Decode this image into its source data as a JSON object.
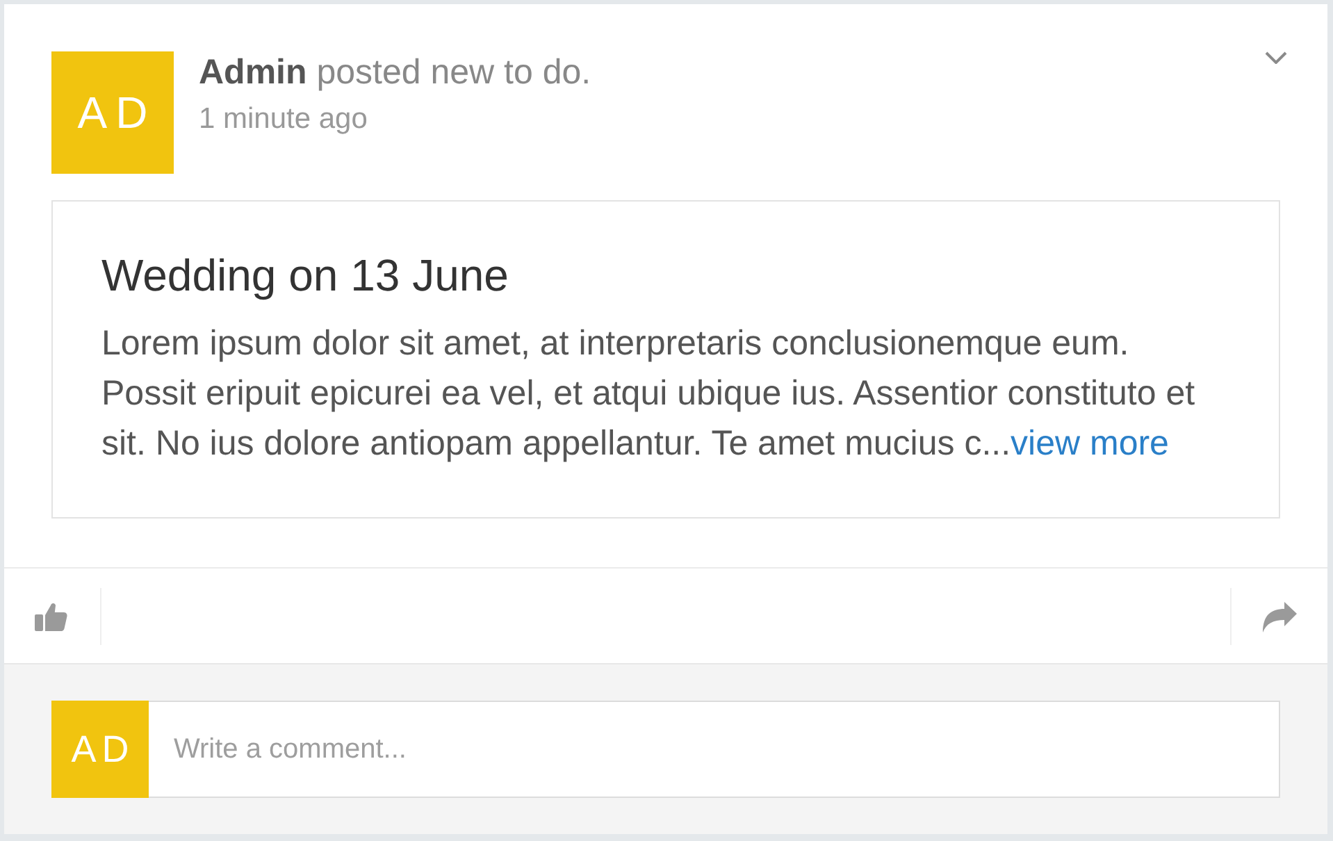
{
  "post": {
    "avatar": "AD",
    "headline": "**Admin** posted new to do.",
    "time": "1 minute ago",
    "title": "Wedding on 13 June",
    "body": "Lorem ipsum dolor sit amet, at interpretaris conclusionemque eum. Possit eripuit epicurei ea vel, et atqui ubique ius. Assentior constituto et sit. No ius dolore antiopam appellantur. Te amet mucius c...",
    "more_link": "view more"
  },
  "comment": {
    "avatar": "AD",
    "placeholder": "Write a comment..."
  }
}
